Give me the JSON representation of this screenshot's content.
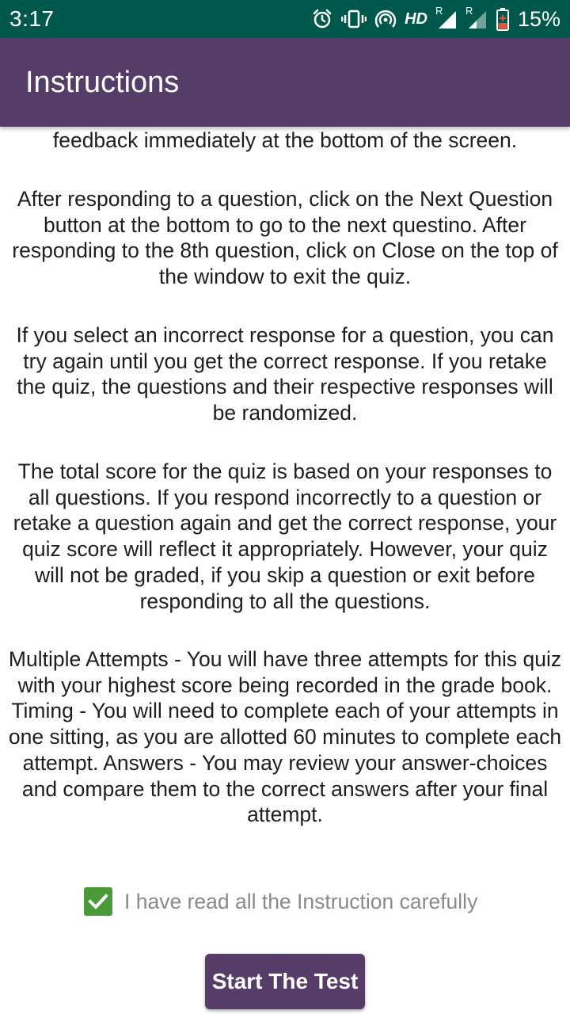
{
  "status_bar": {
    "time": "3:17",
    "hd_label": "HD",
    "signal_label_1": "R",
    "signal_label_2": "R",
    "battery_percent": "15%",
    "background": "#00574b"
  },
  "app_bar": {
    "title": "Instructions",
    "background": "#553d67"
  },
  "instructions": {
    "paragraphs": [
      "feedback immediately at the bottom of the screen.",
      "After responding to a question, click on the Next Question button at the bottom to go to the next questino. After responding to the 8th question, click on Close on the top of the window to exit the quiz.",
      "If you select an incorrect response for a question, you can try again until you get the correct response. If you retake the quiz, the questions and their respective responses will be randomized.",
      "The total score for the quiz is based on your responses to all questions. If you respond incorrectly to a question or retake a question again and get the correct response, your quiz score will reflect it appropriately. However, your quiz will not be graded, if you skip a question or exit before responding to all the questions.",
      "Multiple Attempts - You will have three attempts for this quiz with your highest score being recorded in the grade book. Timing - You will need to complete each of your attempts in one sitting, as you are allotted 60 minutes to complete each attempt. Answers - You may review your answer-choices and compare them to the correct answers after your final attempt."
    ]
  },
  "acknowledgement": {
    "label": "I have read all the Instruction carefully",
    "checked": true,
    "check_color": "#4a9a3a"
  },
  "start_button": {
    "label": "Start The Test"
  }
}
